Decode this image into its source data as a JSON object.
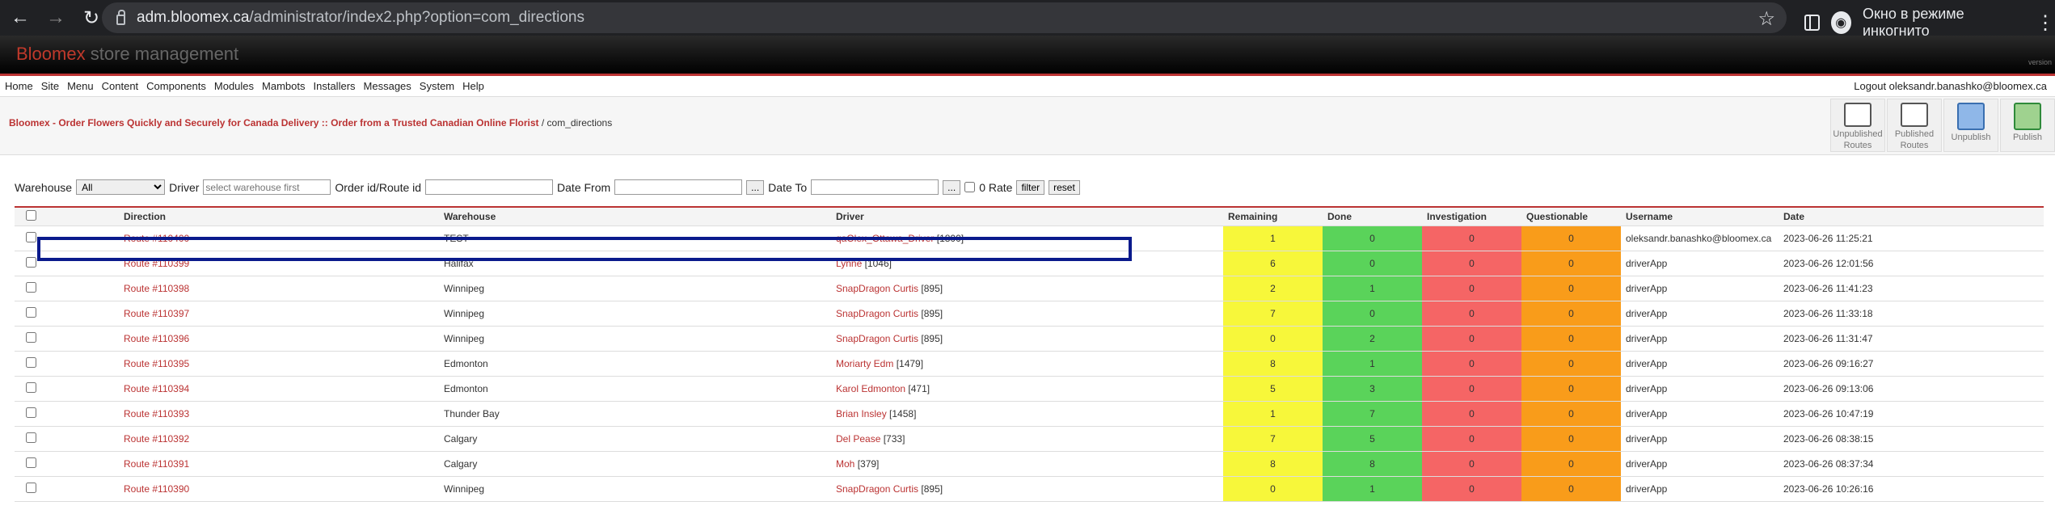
{
  "browser": {
    "url_domain": "adm.bloomex.ca",
    "url_path": "/administrator/index2.php?option=com_directions",
    "incognito_label": "Окно в режиме инкогнито"
  },
  "banner": {
    "brand": "Bloomex",
    "subtitle": "store management",
    "version": "version"
  },
  "menu": {
    "items": [
      "Home",
      "Site",
      "Menu",
      "Content",
      "Components",
      "Modules",
      "Mambots",
      "Installers",
      "Messages",
      "System",
      "Help"
    ],
    "logout": "Logout oleksandr.banashko@bloomex.ca"
  },
  "breadcrumb": {
    "link": "Bloomex - Order Flowers Quickly and Securely for Canada Delivery :: Order from a Trusted Canadian Online Florist",
    "rest": "/ com_directions"
  },
  "toolbar": [
    {
      "label1": "Unpublished",
      "label2": "Routes"
    },
    {
      "label1": "Published",
      "label2": "Routes"
    },
    {
      "label1": "Unpublish",
      "label2": ""
    },
    {
      "label1": "Publish",
      "label2": ""
    }
  ],
  "filters": {
    "warehouse_label": "Warehouse",
    "warehouse_value": "All",
    "driver_label": "Driver",
    "driver_placeholder": "select warehouse first",
    "order_label": "Order id/Route id",
    "date_from_label": "Date From",
    "date_to_label": "Date To",
    "dots": "...",
    "rate_label": "0 Rate",
    "filter_btn": "filter",
    "reset_btn": "reset"
  },
  "table": {
    "headers": [
      "Direction",
      "Warehouse",
      "Driver",
      "Remaining",
      "Done",
      "Investigation",
      "Questionable",
      "Username",
      "Date"
    ],
    "rows": [
      {
        "direction": "Route #110400",
        "warehouse": "TEST",
        "driver": "qaOlex_Ottawa_Driver",
        "driver_id": "[1800]",
        "remaining": "1",
        "done": "0",
        "investigation": "0",
        "questionable": "0",
        "username": "oleksandr.banashko@bloomex.ca",
        "date": "2023-06-26 11:25:21"
      },
      {
        "direction": "Route #110399",
        "warehouse": "Halifax",
        "driver": "Lynne",
        "driver_id": "[1046]",
        "remaining": "6",
        "done": "0",
        "investigation": "0",
        "questionable": "0",
        "username": "driverApp",
        "date": "2023-06-26 12:01:56"
      },
      {
        "direction": "Route #110398",
        "warehouse": "Winnipeg",
        "driver": "SnapDragon Curtis",
        "driver_id": "[895]",
        "remaining": "2",
        "done": "1",
        "investigation": "0",
        "questionable": "0",
        "username": "driverApp",
        "date": "2023-06-26 11:41:23"
      },
      {
        "direction": "Route #110397",
        "warehouse": "Winnipeg",
        "driver": "SnapDragon Curtis",
        "driver_id": "[895]",
        "remaining": "7",
        "done": "0",
        "investigation": "0",
        "questionable": "0",
        "username": "driverApp",
        "date": "2023-06-26 11:33:18"
      },
      {
        "direction": "Route #110396",
        "warehouse": "Winnipeg",
        "driver": "SnapDragon Curtis",
        "driver_id": "[895]",
        "remaining": "0",
        "done": "2",
        "investigation": "0",
        "questionable": "0",
        "username": "driverApp",
        "date": "2023-06-26 11:31:47"
      },
      {
        "direction": "Route #110395",
        "warehouse": "Edmonton",
        "driver": "Moriarty Edm",
        "driver_id": "[1479]",
        "remaining": "8",
        "done": "1",
        "investigation": "0",
        "questionable": "0",
        "username": "driverApp",
        "date": "2023-06-26 09:16:27"
      },
      {
        "direction": "Route #110394",
        "warehouse": "Edmonton",
        "driver": "Karol Edmonton",
        "driver_id": "[471]",
        "remaining": "5",
        "done": "3",
        "investigation": "0",
        "questionable": "0",
        "username": "driverApp",
        "date": "2023-06-26 09:13:06"
      },
      {
        "direction": "Route #110393",
        "warehouse": "Thunder Bay",
        "driver": "Brian Insley",
        "driver_id": "[1458]",
        "remaining": "1",
        "done": "7",
        "investigation": "0",
        "questionable": "0",
        "username": "driverApp",
        "date": "2023-06-26 10:47:19"
      },
      {
        "direction": "Route #110392",
        "warehouse": "Calgary",
        "driver": "Del Pease",
        "driver_id": "[733]",
        "remaining": "7",
        "done": "5",
        "investigation": "0",
        "questionable": "0",
        "username": "driverApp",
        "date": "2023-06-26 08:38:15"
      },
      {
        "direction": "Route #110391",
        "warehouse": "Calgary",
        "driver": "Moh",
        "driver_id": "[379]",
        "remaining": "8",
        "done": "8",
        "investigation": "0",
        "questionable": "0",
        "username": "driverApp",
        "date": "2023-06-26 08:37:34"
      },
      {
        "direction": "Route #110390",
        "warehouse": "Winnipeg",
        "driver": "SnapDragon Curtis",
        "driver_id": "[895]",
        "remaining": "0",
        "done": "1",
        "investigation": "0",
        "questionable": "0",
        "username": "driverApp",
        "date": "2023-06-26 10:26:16"
      }
    ]
  },
  "colors": {
    "remaining": "#f7f73a",
    "done": "#5ad35a",
    "investigation": "#f56565",
    "questionable": "#f99c1a",
    "highlight": "#0a1a8c",
    "brand": "#c0392b"
  }
}
